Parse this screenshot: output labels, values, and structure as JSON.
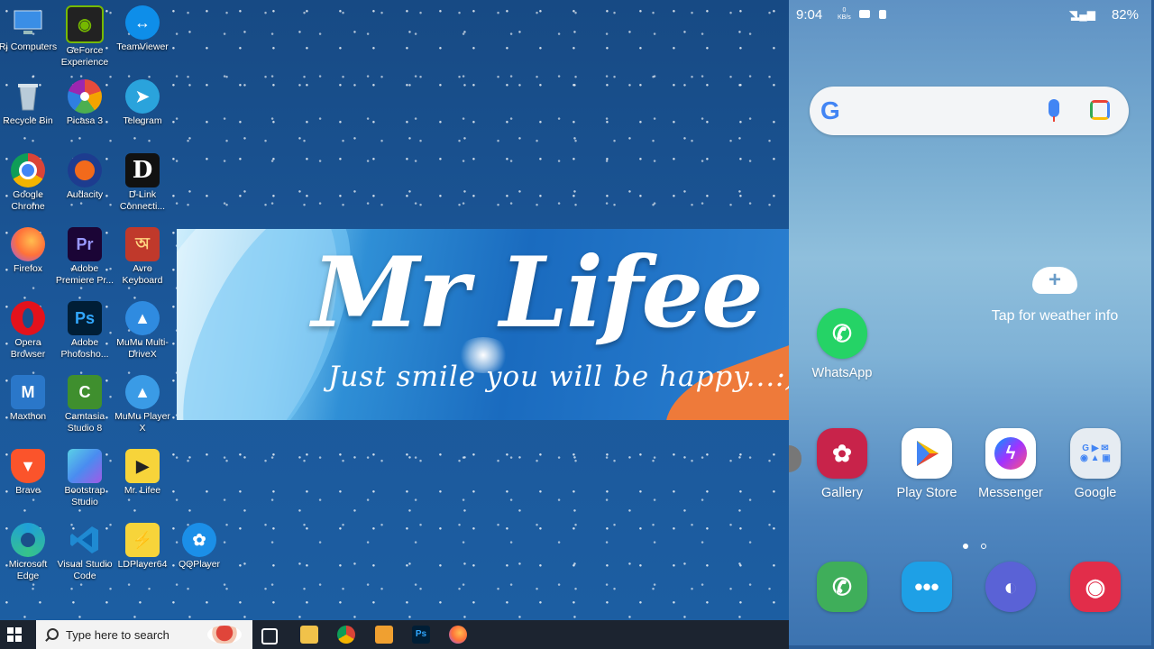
{
  "desktop": {
    "icons": [
      {
        "label": "Rj Computers",
        "icon": "computer-icon",
        "color": "#3a8ee6"
      },
      {
        "label": "GeForce Experience",
        "icon": "nvidia-icon",
        "color": "#76b900"
      },
      {
        "label": "TeamViewer",
        "icon": "teamviewer-icon",
        "color": "#0e8ee9"
      },
      {
        "label": "Recycle Bin",
        "icon": "recycle-bin-icon",
        "color": "#9fb7cc"
      },
      {
        "label": "Picasa 3",
        "icon": "picasa-icon",
        "color": "#f4a300"
      },
      {
        "label": "Telegram",
        "icon": "telegram-icon",
        "color": "#2aa3dc"
      },
      {
        "label": "Google Chrome",
        "icon": "chrome-icon",
        "color": "#db4437"
      },
      {
        "label": "Audacity",
        "icon": "audacity-icon",
        "color": "#f26a1b"
      },
      {
        "label": "D-Link Connecti...",
        "icon": "dlink-icon",
        "color": "#111111"
      },
      {
        "label": "Firefox",
        "icon": "firefox-icon",
        "color": "#ff7139"
      },
      {
        "label": "Adobe Premiere Pr...",
        "icon": "premiere-icon",
        "color": "#2a0a4a"
      },
      {
        "label": "Avro Keyboard",
        "icon": "avro-icon",
        "color": "#c0392b"
      },
      {
        "label": "Opera Browser",
        "icon": "opera-icon",
        "color": "#e3121c"
      },
      {
        "label": "Adobe Photosho...",
        "icon": "photoshop-icon",
        "color": "#0b2a44"
      },
      {
        "label": "MuMu Multi-DriveX",
        "icon": "mumu-multi-icon",
        "color": "#2f8be0"
      },
      {
        "label": "Maxthon",
        "icon": "maxthon-icon",
        "color": "#2a77c9"
      },
      {
        "label": "Camtasia Studio 8",
        "icon": "camtasia-icon",
        "color": "#3f8f2e"
      },
      {
        "label": "MuMu Player X",
        "icon": "mumu-player-icon",
        "color": "#3a9be6"
      },
      {
        "label": "Brave",
        "icon": "brave-icon",
        "color": "#fb542b"
      },
      {
        "label": "Bootstrap Studio",
        "icon": "bootstrap-studio-icon",
        "color": "#4a8cf0"
      },
      {
        "label": "Mr. Lifee",
        "icon": "ldplayer-icon",
        "color": "#f7d43a"
      },
      {
        "label": "Microsoft Edge",
        "icon": "edge-icon",
        "color": "#1fa0d8"
      },
      {
        "label": "Visual Studio Code",
        "icon": "vscode-icon",
        "color": "#1f8ad2"
      },
      {
        "label": "LDPlayer64",
        "icon": "ldplayer64-icon",
        "color": "#f7d43a"
      },
      {
        "label": "QQPlayer",
        "icon": "qqplayer-icon",
        "color": "#1b8fe8"
      }
    ],
    "banner": {
      "title": "Mr Lifee",
      "tagline": "Just smile you will be happy...:)"
    }
  },
  "taskbar": {
    "search_placeholder": "Type here to search"
  },
  "phone": {
    "status": {
      "time": "9:04",
      "speed_value": "0",
      "speed_unit": "KB/s",
      "battery": "82%"
    },
    "weather_text": "Tap for weather info",
    "apps": [
      {
        "label": "WhatsApp",
        "icon": "whatsapp-icon",
        "color": "#25d366"
      },
      {
        "label": "Gallery",
        "icon": "gallery-icon",
        "color": "#c8234a"
      },
      {
        "label": "Play Store",
        "icon": "play-store-icon",
        "color": "#ffffff"
      },
      {
        "label": "Messenger",
        "icon": "messenger-icon",
        "color": "#ffffff"
      },
      {
        "label": "Google",
        "icon": "google-folder-icon",
        "color": "#e6ecf2"
      }
    ],
    "dock": [
      {
        "icon": "phone-icon",
        "color": "#3fae5a"
      },
      {
        "icon": "messages-icon",
        "color": "#1ea0e6"
      },
      {
        "icon": "internet-icon",
        "color": "#5a62d6"
      },
      {
        "icon": "camera-icon",
        "color": "#e22d4a"
      }
    ]
  }
}
